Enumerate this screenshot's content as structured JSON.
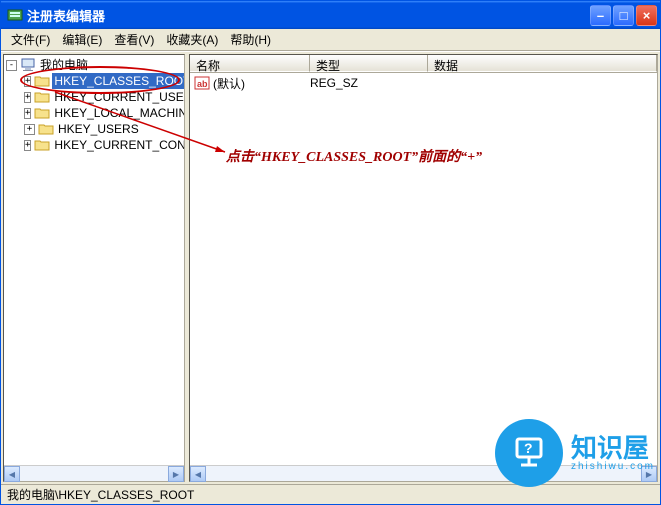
{
  "window": {
    "title": "注册表编辑器"
  },
  "menu": {
    "file": "文件(F)",
    "edit": "编辑(E)",
    "view": "查看(V)",
    "fav": "收藏夹(A)",
    "help": "帮助(H)"
  },
  "tree": {
    "root": "我的电脑",
    "items": [
      {
        "label": "HKEY_CLASSES_ROOT",
        "selected": true,
        "expandable": true
      },
      {
        "label": "HKEY_CURRENT_USER",
        "selected": false,
        "expandable": true
      },
      {
        "label": "HKEY_LOCAL_MACHINE",
        "selected": false,
        "expandable": true
      },
      {
        "label": "HKEY_USERS",
        "selected": false,
        "expandable": true
      },
      {
        "label": "HKEY_CURRENT_CONFIG",
        "selected": false,
        "expandable": true
      }
    ]
  },
  "list": {
    "cols": {
      "name": "名称",
      "type": "类型",
      "data": "数据"
    },
    "rows": [
      {
        "name": "(默认)",
        "type": "REG_SZ",
        "data": ""
      }
    ]
  },
  "annotation": {
    "text": "点击“HKEY_CLASSES_ROOT”前面的“+”"
  },
  "status": {
    "path": "我的电脑\\HKEY_CLASSES_ROOT"
  },
  "watermark": {
    "brand": "知识屋",
    "domain": "zhishiwu.com"
  }
}
